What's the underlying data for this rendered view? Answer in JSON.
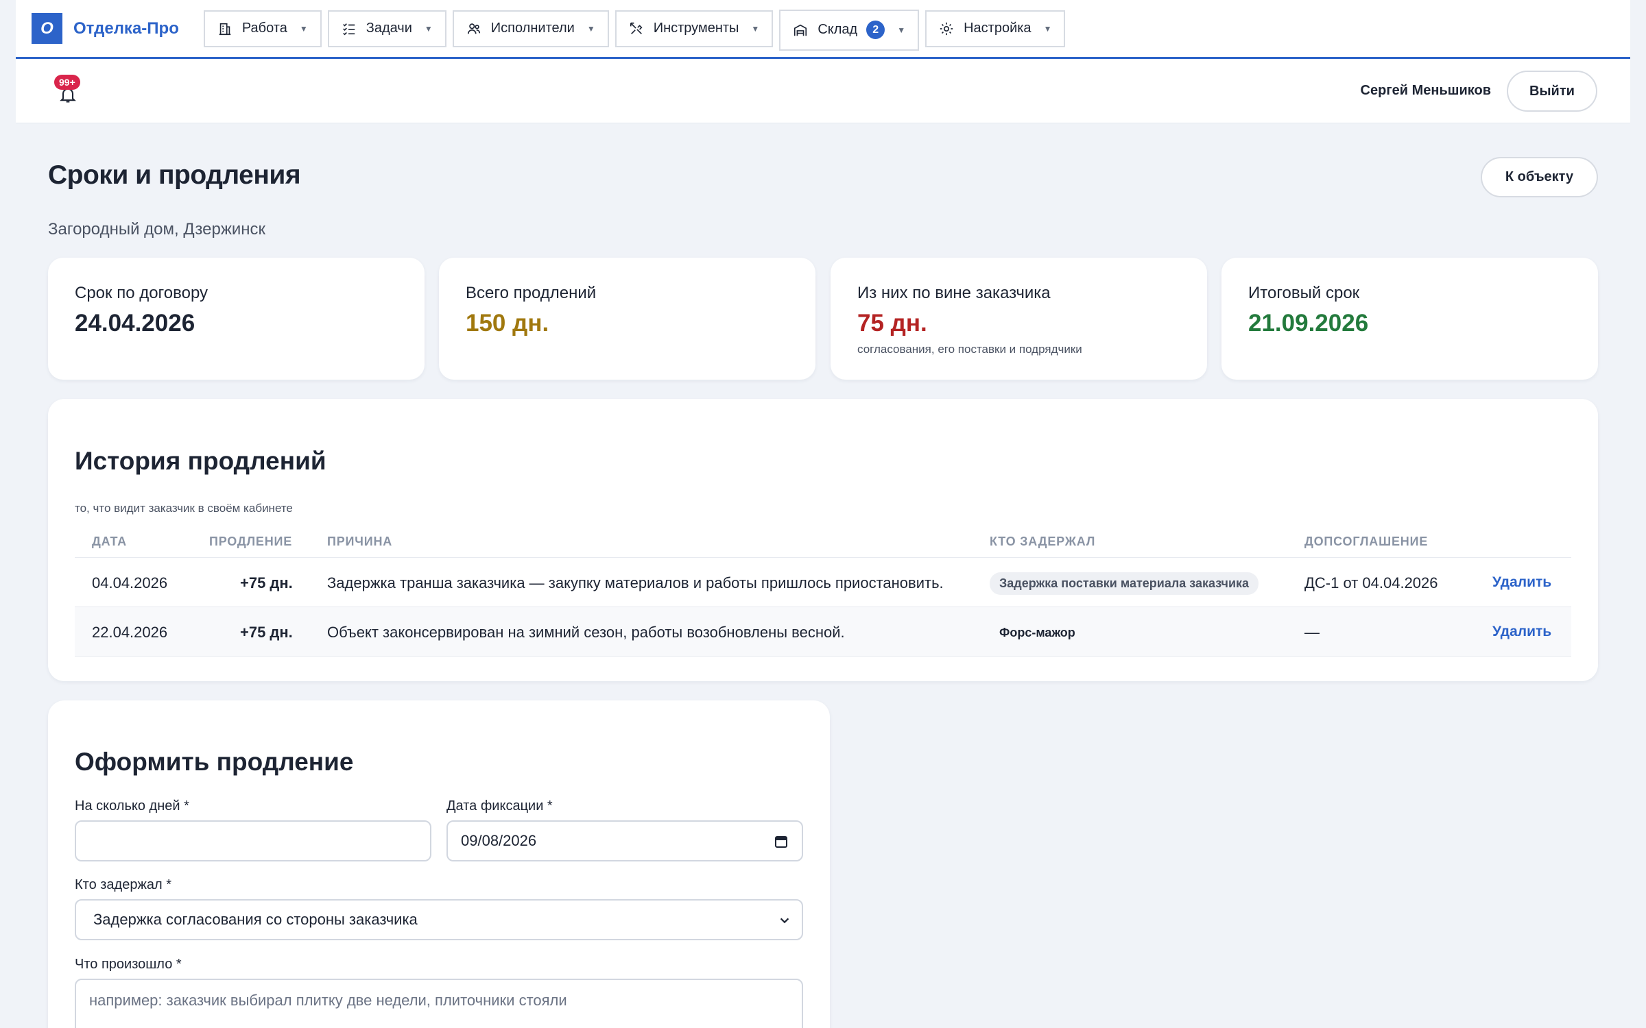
{
  "app": {
    "logo_letter": "О",
    "name": "Отделка-Про"
  },
  "nav": [
    {
      "label": "Работа",
      "icon": "building-icon"
    },
    {
      "label": "Задачи",
      "icon": "checklist-icon"
    },
    {
      "label": "Исполнители",
      "icon": "users-icon"
    },
    {
      "label": "Инструменты",
      "icon": "tools-icon"
    },
    {
      "label": "Склад",
      "icon": "warehouse-icon",
      "badge": "2"
    },
    {
      "label": "Настройка",
      "icon": "gear-icon"
    }
  ],
  "user": {
    "notifications_badge": "99+",
    "name": "Сергей Меньшиков",
    "logout_label": "Выйти"
  },
  "page": {
    "title": "Сроки и продления",
    "back_label": "К объекту",
    "subtitle": "Загородный дом, Дзержинск"
  },
  "stats": [
    {
      "label": "Срок по договору",
      "value": "24.04.2026",
      "color": "#1d2433"
    },
    {
      "label": "Всего продлений",
      "value": "150 дн.",
      "color": "#a0780e"
    },
    {
      "label": "Из них по вине заказчика",
      "value": "75 дн.",
      "note": "согласования, его поставки и подрядчики",
      "color": "#b42323"
    },
    {
      "label": "Итоговый срок",
      "value": "21.09.2026",
      "color": "#237a3c"
    }
  ],
  "history": {
    "title": "История продлений",
    "subtitle": "то, что видит заказчик в своём кабинете",
    "columns": {
      "date": "ДАТА",
      "extension": "ПРОДЛЕНИЕ",
      "reason": "ПРИЧИНА",
      "who": "КТО ЗАДЕРЖАЛ",
      "agreement": "ДОПСОГЛАШЕНИЕ"
    },
    "rows": [
      {
        "date": "04.04.2026",
        "extension": "+75 дн.",
        "reason": "Задержка транша заказчика — закупку материалов и работы пришлось приостановить.",
        "who": "Задержка поставки материала заказчика",
        "agreement": "ДС-1 от 04.04.2026",
        "action": "Удалить"
      },
      {
        "date": "22.04.2026",
        "extension": "+75 дн.",
        "reason": "Объект законсервирован на зимний сезон, работы возобновлены весной.",
        "who": "Форс-мажор",
        "agreement": "—",
        "action": "Удалить"
      }
    ]
  },
  "form": {
    "title": "Оформить продление",
    "days_label": "На сколько дней *",
    "days_value": "",
    "date_label": "Дата фиксации *",
    "date_value": "09/08/2026",
    "who_label": "Кто задержал *",
    "who_value": "Задержка согласования со стороны заказчика",
    "what_label": "Что произошло *",
    "what_placeholder": "например: заказчик выбирал плитку две недели, плиточники стояли"
  },
  "colors": {
    "accent": "#2c63c9",
    "badge_red": "#d9254b"
  }
}
